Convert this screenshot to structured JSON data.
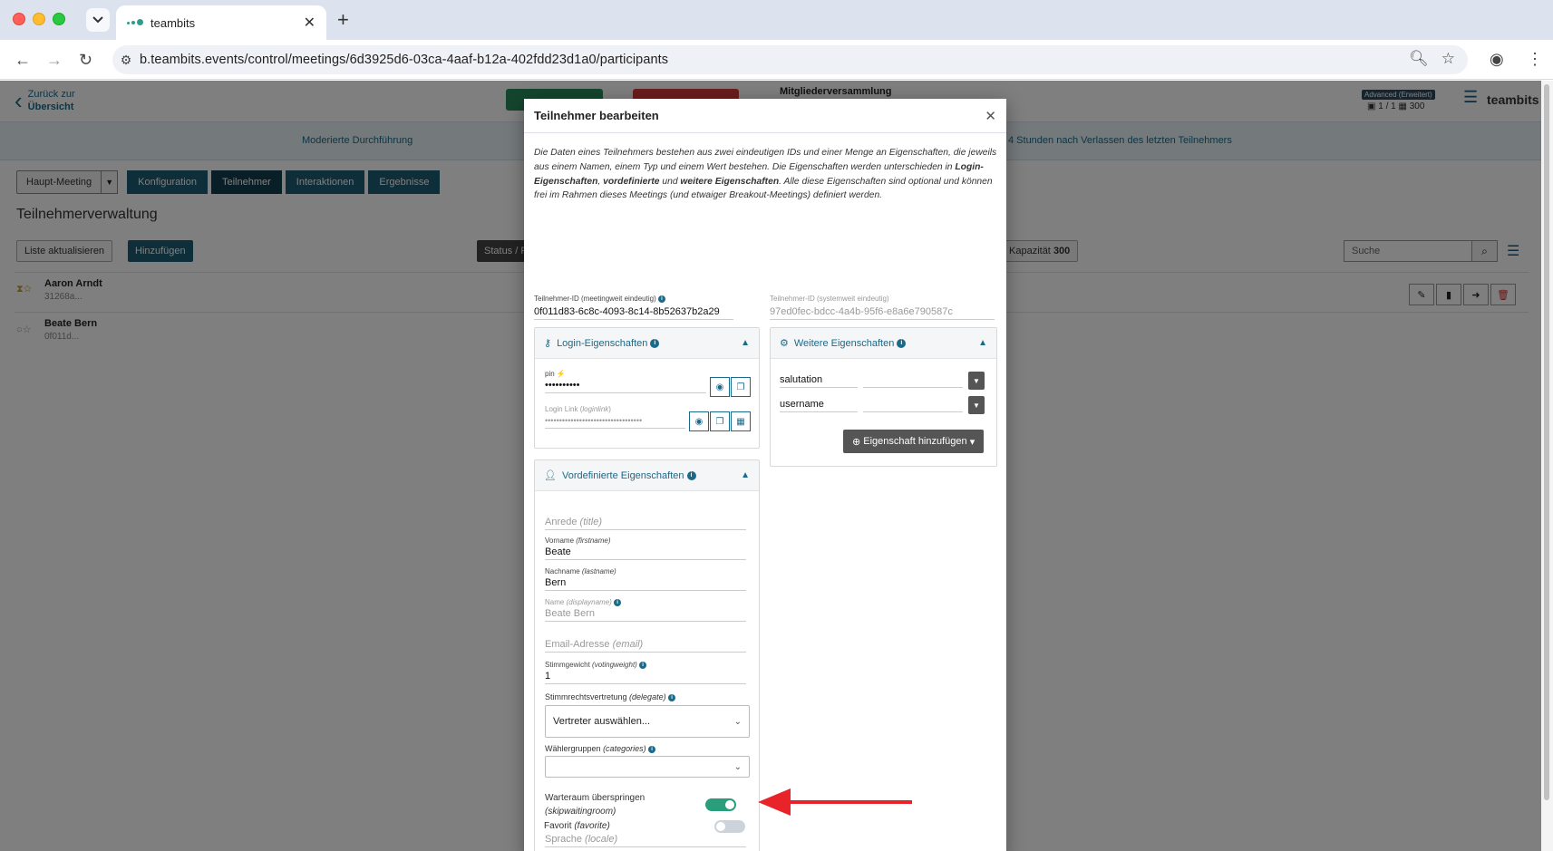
{
  "browser": {
    "tab_title": "teambits",
    "url": "b.teambits.events/control/meetings/6d3925d6-03ca-4aaf-b12a-402fdd23d1a0/participants"
  },
  "app": {
    "back_line1": "Zurück zur",
    "back_line2": "Übersicht",
    "meeting_title": "Mitgliederversammlung",
    "plan_badge": "Advanced (Erweitert)",
    "plan_info": "▣ 1 / 1  ▦ 300",
    "brand": "teambits",
    "mode_left": "Moderierte Durchführung",
    "mode_right": "4 Stunden nach Verlassen des letzten Teilnehmers"
  },
  "steps": {
    "main": "Haupt-Meeting",
    "items": [
      {
        "label": "Konfiguration",
        "active": false
      },
      {
        "label": "Teilnehmer",
        "active": true
      },
      {
        "label": "Interaktionen",
        "active": false
      },
      {
        "label": "Ergebnisse",
        "active": false
      }
    ]
  },
  "list": {
    "title": "Teilnehmerverwaltung",
    "refresh_label": "Liste aktualisieren",
    "add_label": "Hinzufügen",
    "status_label": "Status / F",
    "capacity_label": "Kapazität",
    "capacity_value": "300",
    "search_placeholder": "Suche",
    "rows": [
      {
        "name": "Aaron Arndt",
        "id": "31268a..."
      },
      {
        "name": "Beate Bern",
        "id": "0f011d..."
      }
    ]
  },
  "modal": {
    "title": "Teilnehmer bearbeiten",
    "intro_1": "Die Daten eines Teilnehmers bestehen aus zwei eindeutigen IDs und einer Menge an Eigenschaften, die jeweils aus einem Namen, einem Typ und einem Wert bestehen. Die Eigenschaften werden unterschieden in ",
    "intro_b1": "Login-Eigenschaften",
    "intro_2": ", ",
    "intro_b2": "vordefinierte",
    "intro_3": " und ",
    "intro_b3": "weitere Eigenschaften",
    "intro_4": ". Alle diese Eigenschaften sind optional und können frei im Rahmen dieses Meetings (und etwaiger Breakout-Meetings) definiert werden.",
    "id_meeting_label": "Teilnehmer-ID (meetingweit eindeutig)",
    "id_meeting_value": "0f011d83-6c8c-4093-8c14-8b52637b2a29",
    "id_system_label": "Teilnehmer-ID (systemweit eindeutig)",
    "id_system_value": "97ed0fec-bdcc-4a4b-95f6-e8a6e790587c",
    "login": {
      "title": "Login-Eigenschaften",
      "pin_label": "pin",
      "pin_value": "••••••••••",
      "link_label": "Login Link",
      "link_key": "loginlink",
      "link_value": "••••••••••••••••••••••••••••••••••"
    },
    "predefined": {
      "title": "Vordefinierte Eigenschaften",
      "anrede_ph": "Anrede",
      "anrede_key": "(title)",
      "vorname_label": "Vorname",
      "vorname_key": "(firstname)",
      "vorname_value": "Beate",
      "nachname_label": "Nachname",
      "nachname_key": "(lastname)",
      "nachname_value": "Bern",
      "name_label": "Name",
      "name_key": "(displayname)",
      "name_value": "Beate Bern",
      "email_ph": "Email-Adresse",
      "email_key": "(email)",
      "stimm_label": "Stimmgewicht",
      "stimm_key": "(votingweight)",
      "stimm_value": "1",
      "delegate_label": "Stimmrechtsvertretung",
      "delegate_key": "(delegate)",
      "delegate_value": "Vertreter auswählen...",
      "groups_label": "Wählergruppen",
      "groups_key": "(categories)",
      "groups_value": "",
      "skip_label": "Warteraum überspringen",
      "skip_key": "(skipwaitingroom)",
      "skip_on": true,
      "lang_ph": "Sprache",
      "lang_key": "(locale)",
      "fav_label": "Favorit",
      "fav_key": "(favorite)",
      "fav_on": false
    },
    "further": {
      "title": "Weitere Eigenschaften",
      "props": [
        "salutation",
        "username"
      ],
      "add_label": "Eigenschaft hinzufügen"
    }
  },
  "colors": {
    "accent": "#1b6a8a",
    "step_bg": "#1c5d73",
    "toggle_on": "#2a9d7a",
    "arrow": "#e8232a"
  },
  "icons": [
    "back-chevron-icon",
    "key-icon",
    "user-cog-icon",
    "gear-icon",
    "eye-icon",
    "copy-icon",
    "qr-icon",
    "search-icon",
    "menu-icon",
    "close-icon"
  ]
}
